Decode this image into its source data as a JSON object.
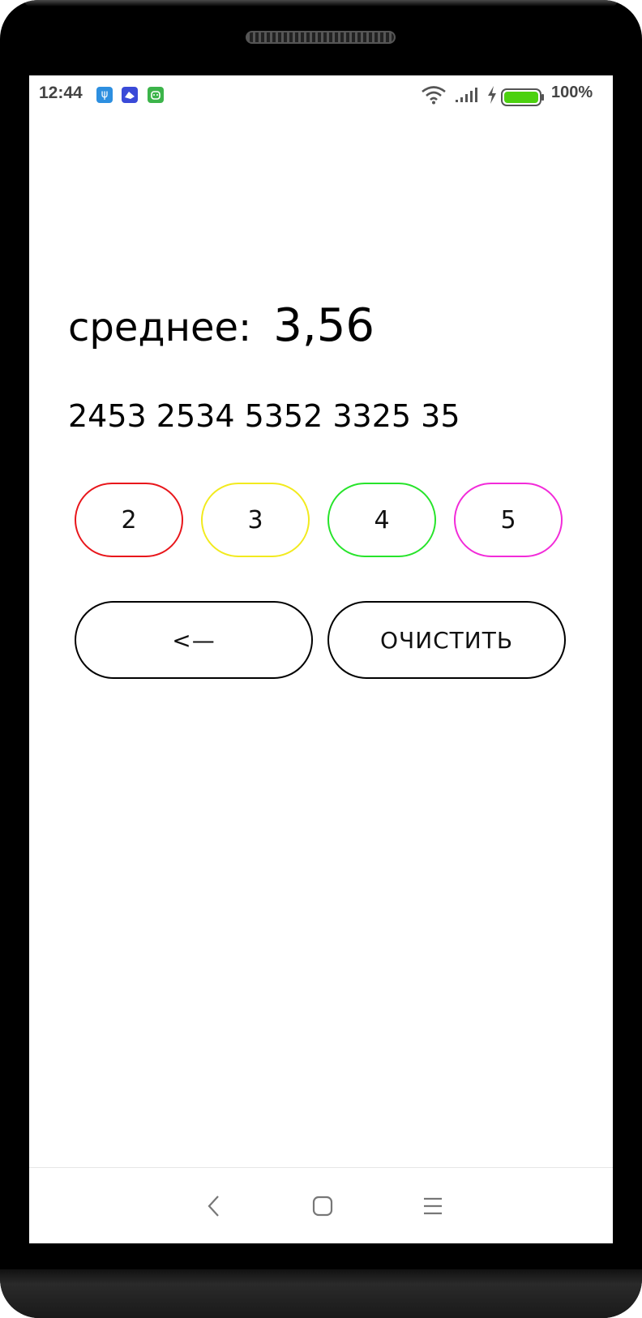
{
  "status_bar": {
    "time": "12:44",
    "battery_percent": "100%",
    "battery_level": 1.0,
    "notifications": [
      "usb-icon",
      "app-icon",
      "android-icon"
    ],
    "indicators": [
      "wifi-icon",
      "signal-icon",
      "charging-icon",
      "battery-icon"
    ]
  },
  "main": {
    "average_label": "среднее:",
    "average_value": "3,56",
    "grades_display": "2453 2534 5352 3325 35",
    "grade_buttons": [
      {
        "label": "2",
        "color": "#e8161b"
      },
      {
        "label": "3",
        "color": "#f2ea1e"
      },
      {
        "label": "4",
        "color": "#27e42b"
      },
      {
        "label": "5",
        "color": "#f22bd9"
      }
    ],
    "backspace_label": "<—",
    "clear_label": "ОЧИСТИТЬ"
  },
  "nav": {
    "items": [
      "back-icon",
      "home-icon",
      "recents-icon"
    ]
  },
  "colors": {
    "battery_fill": "#4cd10f",
    "status_text": "#444444"
  }
}
